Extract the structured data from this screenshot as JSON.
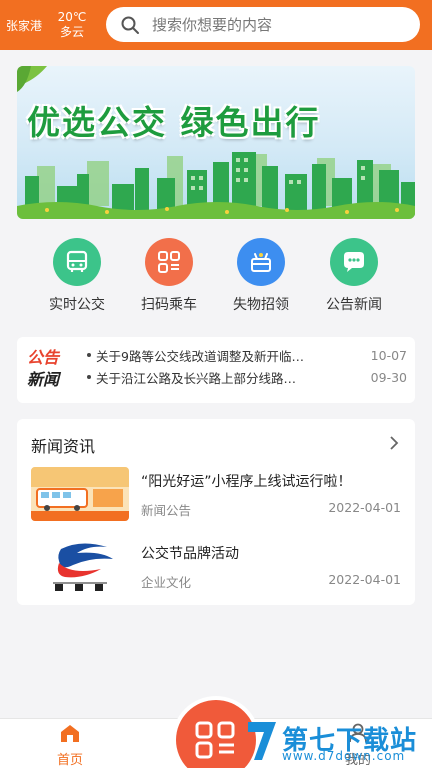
{
  "header": {
    "city": "张家港",
    "temperature": "20℃",
    "weather": "多云",
    "search_placeholder": "搜索你想要的内容"
  },
  "banner": {
    "title": "优选公交  绿色出行"
  },
  "quick_nav": [
    {
      "label": "实时公交",
      "icon": "bus-icon",
      "color": "#3cc48a"
    },
    {
      "label": "扫码乘车",
      "icon": "scan-qr-icon",
      "color": "#f26f4a"
    },
    {
      "label": "失物招领",
      "icon": "lost-found-icon",
      "color": "#3d8ef0"
    },
    {
      "label": "公告新闻",
      "icon": "chat-bubble-icon",
      "color": "#3cc48a"
    }
  ],
  "notice": {
    "logo_line1": "公告",
    "logo_line2": "新闻",
    "items": [
      {
        "text": "关于9路等公交线改道调整及新开临…",
        "date": "10-07"
      },
      {
        "text": "关于沿江公路及长兴路上部分线路…",
        "date": "09-30"
      }
    ]
  },
  "news": {
    "title": "新闻资讯",
    "items": [
      {
        "headline": "“阳光好运”小程序上线试运行啦！",
        "category": "新闻公告",
        "date": "2022-04-01"
      },
      {
        "headline": "公交节品牌活动",
        "category": "企业文化",
        "date": "2022-04-01"
      }
    ]
  },
  "bottom_nav": {
    "home_label": "首页",
    "mine_label": "我的"
  },
  "watermark": {
    "text": "第七下载站",
    "url": "www.d7down.com"
  },
  "colors": {
    "accent": "#f26f21",
    "green": "#3cc48a",
    "blue": "#3d8ef0",
    "red": "#f05a3a"
  }
}
